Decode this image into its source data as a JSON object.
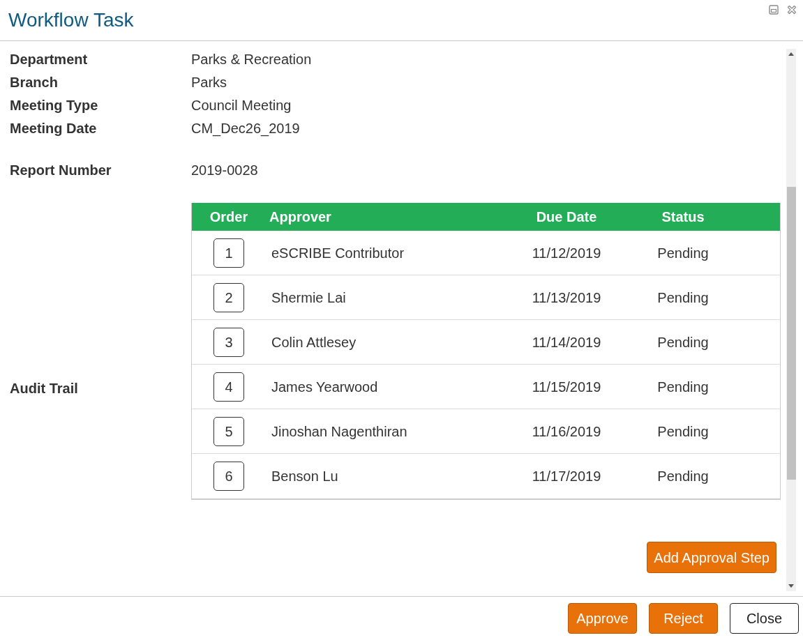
{
  "window": {
    "title": "Workflow Task"
  },
  "field_groups": [
    {
      "fields": [
        {
          "label": "Department",
          "value": "Parks & Recreation"
        },
        {
          "label": "Branch",
          "value": "Parks"
        },
        {
          "label": "Meeting Type",
          "value": "Council Meeting"
        },
        {
          "label": "Meeting Date",
          "value": "CM_Dec26_2019"
        }
      ]
    },
    {
      "fields": [
        {
          "label": "Report Number",
          "value": "2019-0028"
        }
      ]
    }
  ],
  "audit_trail": {
    "label": "Audit Trail",
    "table": {
      "columns": [
        "Order",
        "Approver",
        "Due Date",
        "Status"
      ],
      "rows": [
        {
          "order": "1",
          "approver": "eSCRIBE Contributor",
          "due_date": "11/12/2019",
          "status": "Pending"
        },
        {
          "order": "2",
          "approver": "Shermie Lai",
          "due_date": "11/13/2019",
          "status": "Pending"
        },
        {
          "order": "3",
          "approver": "Colin Attlesey",
          "due_date": "11/14/2019",
          "status": "Pending"
        },
        {
          "order": "4",
          "approver": "James Yearwood",
          "due_date": "11/15/2019",
          "status": "Pending"
        },
        {
          "order": "5",
          "approver": "Jinoshan Nagenthiran",
          "due_date": "11/16/2019",
          "status": "Pending"
        },
        {
          "order": "6",
          "approver": "Benson Lu",
          "due_date": "11/17/2019",
          "status": "Pending"
        }
      ]
    },
    "add_button": "Add Approval Step"
  },
  "buttons": [
    {
      "label": "Approve",
      "kind": "primary"
    },
    {
      "label": "Reject",
      "kind": "primary"
    },
    {
      "label": "Close",
      "kind": "secondary"
    }
  ]
}
